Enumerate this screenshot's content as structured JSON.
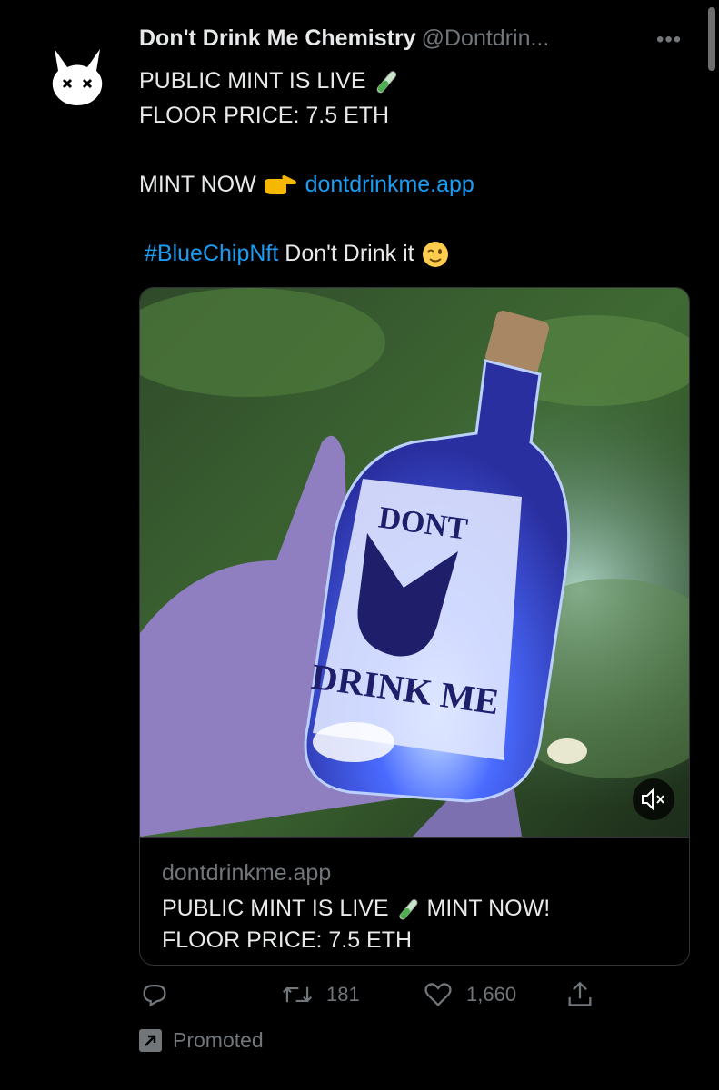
{
  "tweet": {
    "author_name": "Don't Drink Me Chemistry",
    "author_handle": "@Dontdrin...",
    "more_label": "•••",
    "lines": [
      "PUBLIC MINT IS LIVE",
      "FLOOR PRICE: 7.5 ETH",
      "MINT NOW",
      "dontdrinkme.app",
      "#BlueChipNft",
      "Don't Drink it"
    ]
  },
  "card": {
    "image_label_top": "DONT",
    "image_label_bottom": "DRINK ME",
    "domain": "dontdrinkme.app",
    "title_1": "PUBLIC MINT IS LIVE",
    "title_2": "MINT NOW!",
    "title_3": "FLOOR PRICE: 7.5 ETH"
  },
  "actions": {
    "retweets": "181",
    "likes": "1,660"
  },
  "footer": {
    "promoted_label": "Promoted"
  },
  "icons": {
    "reply": "reply-icon",
    "retweet": "retweet-icon",
    "like": "heart-icon",
    "share": "share-icon",
    "mute": "speaker-muted-icon",
    "promoted": "promoted-arrow-icon"
  },
  "colors": {
    "background": "#000000",
    "text": "#e7e9ea",
    "muted": "#71767b",
    "link": "#1d9bf0",
    "border": "#2f3336"
  }
}
